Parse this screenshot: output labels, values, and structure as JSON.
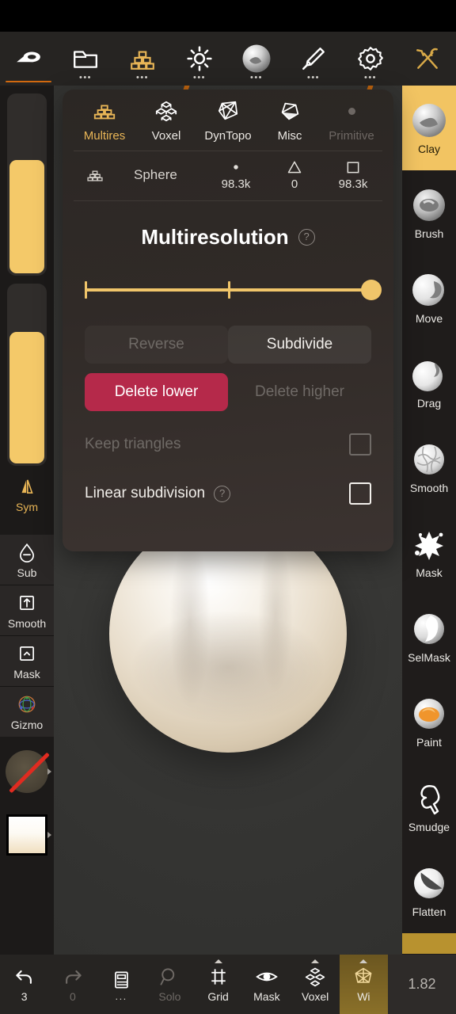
{
  "app": {
    "version": "1.82"
  },
  "topbar": {
    "items": [
      {
        "icon": "sculpt-icon",
        "label": "",
        "dots": false,
        "active": true,
        "accent": "#d2690f"
      },
      {
        "icon": "folder-icon",
        "label": "",
        "dots": true,
        "active": false
      },
      {
        "icon": "topology-icon",
        "label": "",
        "dots": true,
        "active": true
      },
      {
        "icon": "lighting-icon",
        "label": "",
        "dots": true,
        "active": false
      },
      {
        "icon": "material-sphere-icon",
        "label": "",
        "dots": true,
        "active": false
      },
      {
        "icon": "paint-brush-icon",
        "label": "",
        "dots": true,
        "active": false
      },
      {
        "icon": "gear-icon",
        "label": "",
        "dots": true,
        "active": false
      },
      {
        "icon": "tools-icon",
        "label": "",
        "dots": false,
        "active": false
      }
    ]
  },
  "panel": {
    "tabs": [
      {
        "label": "Multires",
        "icon": "multires-icon",
        "state": "active"
      },
      {
        "label": "Voxel",
        "icon": "voxel-icon",
        "state": "normal"
      },
      {
        "label": "DynTopo",
        "icon": "dyntopo-icon",
        "state": "normal"
      },
      {
        "label": "Misc",
        "icon": "misc-icon",
        "state": "normal"
      },
      {
        "label": "Primitive",
        "icon": "dot-icon",
        "state": "disabled"
      }
    ],
    "stats": {
      "object_icon": "multires-icon",
      "object_name": "Sphere",
      "entries": [
        {
          "glyph": "vertex-dot-icon",
          "value": "98.3k"
        },
        {
          "glyph": "triangle-icon",
          "value": "0"
        },
        {
          "glyph": "quad-icon",
          "value": "98.3k"
        }
      ]
    },
    "title": "Multiresolution",
    "help_glyph": "?",
    "slider": {
      "ticks_pct": [
        0,
        50
      ],
      "value_pct": 100
    },
    "buttons": {
      "reverse": "Reverse",
      "subdivide": "Subdivide",
      "delete_lower": "Delete lower",
      "delete_higher": "Delete higher"
    },
    "checkboxes": [
      {
        "label": "Keep triangles",
        "checked": false,
        "disabled": true,
        "help": false
      },
      {
        "label": "Linear subdivision",
        "checked": false,
        "disabled": false,
        "help": true
      }
    ],
    "colors": {
      "accent": "#f0c56a",
      "danger": "#b5294a"
    }
  },
  "left_sidebar": {
    "sliders": [
      {
        "name": "brush-radius-slider",
        "fill_pct": 62
      },
      {
        "name": "brush-intensity-slider",
        "fill_pct": 72
      }
    ],
    "buttons": [
      {
        "label": "Sym",
        "icon": "symmetry-icon",
        "active": true
      },
      {
        "label": "Sub",
        "icon": "subtract-drop-icon",
        "active": false
      },
      {
        "label": "Smooth",
        "icon": "smooth-square-icon",
        "active": false
      },
      {
        "label": "Mask",
        "icon": "mask-square-icon",
        "active": false
      },
      {
        "label": "Gizmo",
        "icon": "gizmo-icon",
        "active": false
      }
    ],
    "swatches": [
      {
        "name": "alpha-swatch",
        "disabled": true
      },
      {
        "name": "material-swatch",
        "disabled": false
      }
    ]
  },
  "right_sidebar": {
    "brushes": [
      {
        "label": "Clay",
        "selected": true
      },
      {
        "label": "Brush",
        "selected": false
      },
      {
        "label": "Move",
        "selected": false
      },
      {
        "label": "Drag",
        "selected": false
      },
      {
        "label": "Smooth",
        "selected": false
      },
      {
        "label": "Mask",
        "selected": false
      },
      {
        "label": "SelMask",
        "selected": false
      },
      {
        "label": "Paint",
        "selected": false
      },
      {
        "label": "Smudge",
        "selected": false
      },
      {
        "label": "Flatten",
        "selected": false
      }
    ]
  },
  "bottombar": {
    "items": [
      {
        "label": "3",
        "icon": "undo-icon",
        "dim": false,
        "caret": false,
        "highlight": false
      },
      {
        "label": "0",
        "icon": "redo-icon",
        "dim": true,
        "caret": false,
        "highlight": false
      },
      {
        "label": "...",
        "icon": "layers-icon",
        "dim": false,
        "caret": false,
        "highlight": false
      },
      {
        "label": "Solo",
        "icon": "magnifier-icon",
        "dim": true,
        "caret": false,
        "highlight": false
      },
      {
        "label": "Grid",
        "icon": "grid-icon",
        "dim": false,
        "caret": true,
        "highlight": false
      },
      {
        "label": "Mask",
        "icon": "eye-icon",
        "dim": false,
        "caret": false,
        "highlight": false
      },
      {
        "label": "Voxel",
        "icon": "voxel-icon",
        "dim": false,
        "caret": true,
        "highlight": false
      },
      {
        "label": "Wi",
        "icon": "wireframe-icon",
        "dim": false,
        "caret": true,
        "highlight": true
      }
    ]
  }
}
